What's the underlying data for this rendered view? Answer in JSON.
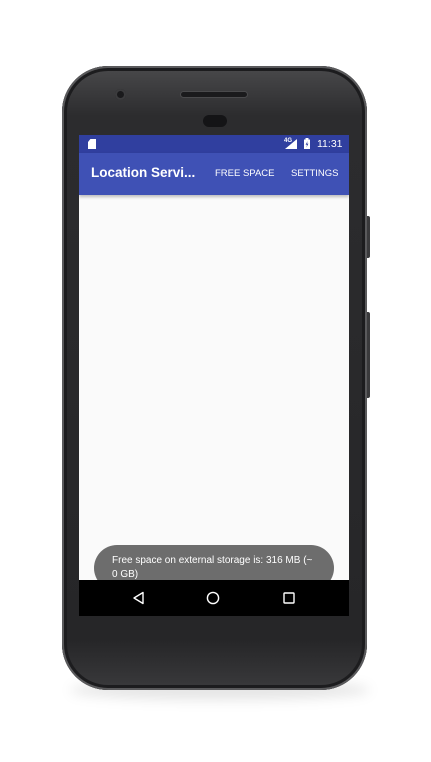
{
  "status_bar": {
    "network_type": "4G",
    "time": "11:31",
    "icons": [
      "sd-card-icon",
      "signal-icon",
      "battery-icon"
    ]
  },
  "app_bar": {
    "title": "Location Servi...",
    "actions": [
      {
        "label": "FREE SPACE"
      },
      {
        "label": "SETTINGS"
      }
    ]
  },
  "toast": {
    "message": "Free space on external storage is: 316 MB (~ 0 GB)"
  },
  "nav_bar": {
    "icons": [
      "back-icon",
      "home-icon",
      "recents-icon"
    ]
  },
  "colors": {
    "primary": "#3f51b5",
    "primary_dark": "#303f9f",
    "toast_bg": "#6d6d6d",
    "screen_bg": "#fafafa",
    "phone_body": "#2c2c2e"
  }
}
